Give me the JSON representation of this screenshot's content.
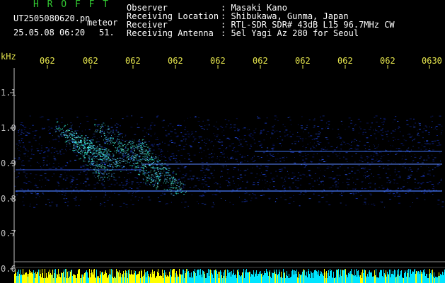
{
  "header": {
    "app_title": "H R O F F T",
    "file_name": "UT2505080620.pn",
    "mode": "meteor",
    "date_time": "25.05.08 06:20",
    "count": "51.",
    "info": [
      {
        "label": "Observer",
        "value": ": Masaki Kano"
      },
      {
        "label": "Receiving Location",
        "value": ": Shibukawa, Gunma, Japan"
      },
      {
        "label": "Receiver",
        "value": ": RTL-SDR SDR# 43dB L15 96.7MHz CW"
      },
      {
        "label": "Receiving Antenna",
        "value": ": 5el Yagi Az 280 for Seoul"
      }
    ]
  },
  "colors": {
    "title_green": "#33cc33",
    "text_white": "#ffffff",
    "label_yellow": "#e6e64d",
    "axis_gray": "#bfbfbf",
    "noise_blue": "#1a3fd9",
    "strong_cyan": "#33ffdd",
    "meter_yellow": "#ffff00",
    "meter_cyan": "#00e5ff"
  },
  "time_axis": {
    "labels": [
      "062",
      "062",
      "062",
      "062",
      "062",
      "062",
      "062",
      "062",
      "062",
      "0630"
    ]
  },
  "freq_axis": {
    "unit": "kHz",
    "labels": [
      "1.1",
      "1.0",
      "0.9",
      "0.8",
      "0.7",
      "0.6"
    ]
  }
}
